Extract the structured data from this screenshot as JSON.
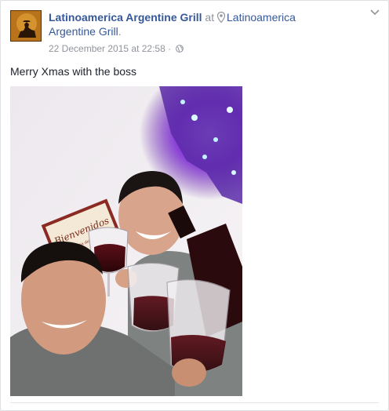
{
  "post": {
    "page_name": "Latinoamerica Argentine Grill",
    "connector": "at",
    "place_name_line1": "Latinoamerica",
    "place_name_line2": "Argentine Grill",
    "place_suffix": ".",
    "timestamp": "22 December 2015 at 22:58",
    "separator": "·",
    "text": "Merry Xmas with the boss",
    "privacy_icon": "globe-icon",
    "options_icon": "chevron-down-icon"
  },
  "photo": {
    "sign_text_main": "Bienvenidos",
    "sign_text_sub": "a la casa del Malbec"
  },
  "colors": {
    "link": "#365899",
    "meta": "#90949c",
    "text": "#1d2129"
  }
}
